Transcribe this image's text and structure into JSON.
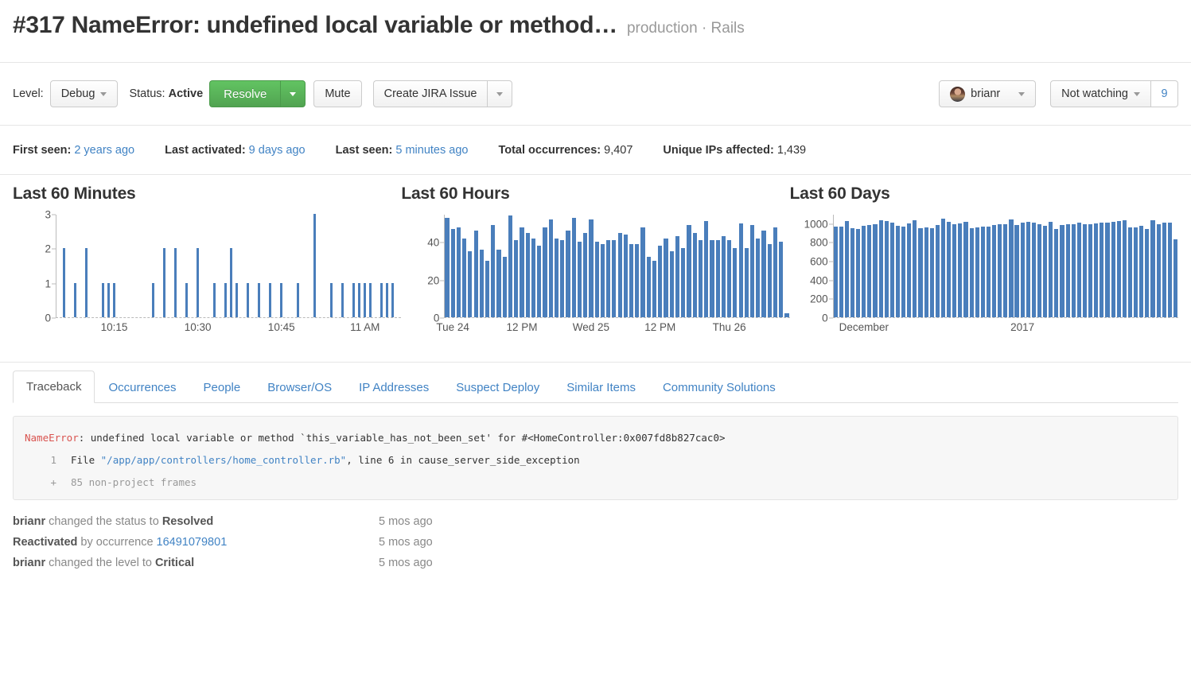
{
  "header": {
    "title": "#317 NameError: undefined local variable or method…",
    "subtitle": "production · Rails"
  },
  "toolbar": {
    "level_label": "Level:",
    "level_value": "Debug",
    "status_label": "Status:",
    "status_value": "Active",
    "resolve_label": "Resolve",
    "mute_label": "Mute",
    "jira_label": "Create JIRA Issue",
    "user_label": "brianr",
    "watching_label": "Not watching",
    "watching_count": "9"
  },
  "stats": [
    {
      "key": "First seen:",
      "value": "2 years ago",
      "link": true
    },
    {
      "key": "Last activated:",
      "value": "9 days ago",
      "link": true
    },
    {
      "key": "Last seen:",
      "value": "5 minutes ago",
      "link": true
    },
    {
      "key": "Total occurrences:",
      "value": "9,407",
      "link": false
    },
    {
      "key": "Unique IPs affected:",
      "value": "1,439",
      "link": false
    }
  ],
  "chart_data": [
    {
      "type": "bar",
      "title": "Last 60 Minutes",
      "xlabel": "",
      "ylabel": "",
      "ylim": [
        0,
        3
      ],
      "yticks": [
        0,
        1,
        2,
        3
      ],
      "ytick_labels": [
        "0",
        "1",
        "2",
        "3"
      ],
      "xtick_labels": [
        "10:15",
        "10:30",
        "10:45",
        "11 AM"
      ],
      "xtick_positions": [
        10,
        25,
        40,
        55
      ],
      "grid": false,
      "bar_color": "#4a7ebb",
      "n": 62,
      "values": [
        0,
        2,
        0,
        1,
        0,
        2,
        0,
        0,
        1,
        1,
        1,
        0,
        0,
        0,
        0,
        0,
        0,
        1,
        0,
        2,
        0,
        2,
        0,
        1,
        0,
        2,
        0,
        0,
        1,
        0,
        1,
        2,
        1,
        0,
        1,
        0,
        1,
        0,
        1,
        0,
        1,
        0,
        0,
        1,
        0,
        0,
        3,
        0,
        0,
        1,
        0,
        1,
        0,
        1,
        1,
        1,
        1,
        0,
        1,
        1,
        1,
        0
      ]
    },
    {
      "type": "bar",
      "title": "Last 60 Hours",
      "xlabel": "",
      "ylabel": "",
      "ylim": [
        0,
        55
      ],
      "yticks": [
        0,
        20,
        40
      ],
      "ytick_labels": [
        "0",
        "20",
        "40"
      ],
      "xtick_labels": [
        "Tue 24",
        "12 PM",
        "Wed 25",
        "12 PM",
        "Thu 26"
      ],
      "xtick_positions": [
        1,
        13,
        25,
        37,
        49
      ],
      "grid": false,
      "bar_color": "#4a7ebb",
      "n": 61,
      "values": [
        53,
        47,
        48,
        42,
        35,
        46,
        36,
        30,
        49,
        36,
        32,
        54,
        41,
        48,
        45,
        42,
        38,
        48,
        52,
        42,
        41,
        46,
        53,
        40,
        45,
        52,
        40,
        39,
        41,
        41,
        45,
        44,
        39,
        39,
        48,
        32,
        30,
        38,
        42,
        35,
        43,
        37,
        49,
        45,
        41,
        51,
        41,
        41,
        43,
        41,
        37,
        50,
        37,
        49,
        42,
        46,
        39,
        48,
        40,
        2
      ]
    },
    {
      "type": "bar",
      "title": "Last 60 Days",
      "xlabel": "",
      "ylabel": "",
      "ylim": [
        0,
        1100
      ],
      "yticks": [
        0,
        200,
        400,
        600,
        800,
        1000
      ],
      "ytick_labels": [
        "0",
        "200",
        "400",
        "600",
        "800",
        "1000"
      ],
      "xtick_labels": [
        "December",
        "2017"
      ],
      "xtick_positions": [
        5,
        33
      ],
      "grid": false,
      "bar_color": "#4a7ebb",
      "n": 60,
      "values": [
        965,
        963,
        1020,
        948,
        938,
        970,
        985,
        989,
        1029,
        1028,
        1008,
        977,
        965,
        999,
        1030,
        948,
        957,
        950,
        983,
        1048,
        1012,
        993,
        996,
        1012,
        947,
        957,
        968,
        964,
        980,
        986,
        994,
        1037,
        980,
        1006,
        1014,
        1010,
        990,
        977,
        1017,
        938,
        983,
        992,
        987,
        1005,
        992,
        988,
        1000,
        1005,
        1010,
        1014,
        1022,
        1036,
        960,
        953,
        972,
        938,
        1031,
        989,
        1003,
        1005,
        830
      ]
    }
  ],
  "tabs": [
    {
      "label": "Traceback",
      "active": true
    },
    {
      "label": "Occurrences",
      "active": false
    },
    {
      "label": "People",
      "active": false
    },
    {
      "label": "Browser/OS",
      "active": false
    },
    {
      "label": "IP Addresses",
      "active": false
    },
    {
      "label": "Suspect Deploy",
      "active": false
    },
    {
      "label": "Similar Items",
      "active": false
    },
    {
      "label": "Community Solutions",
      "active": false
    }
  ],
  "traceback": {
    "error_type": "NameError",
    "error_message": ": undefined local variable or method `this_variable_has_not_been_set' for #<HomeController:0x007fd8b827cac0>",
    "frame_number": "1",
    "frame_prefix": "File ",
    "frame_path": "\"/app/app/controllers/home_controller.rb\"",
    "frame_suffix": ", line 6 in cause_server_side_exception",
    "collapse_marker": "+",
    "collapse_text": "85 non-project frames"
  },
  "activity": [
    {
      "actor": "brianr",
      "mid": " changed the status to ",
      "target": "Resolved",
      "link": "",
      "time": "5 mos ago"
    },
    {
      "actor": "Reactivated",
      "mid": " by occurrence ",
      "target": "",
      "link": "16491079801",
      "time": "5 mos ago"
    },
    {
      "actor": "brianr",
      "mid": " changed the level to ",
      "target": "Critical",
      "link": "",
      "time": "5 mos ago"
    }
  ]
}
